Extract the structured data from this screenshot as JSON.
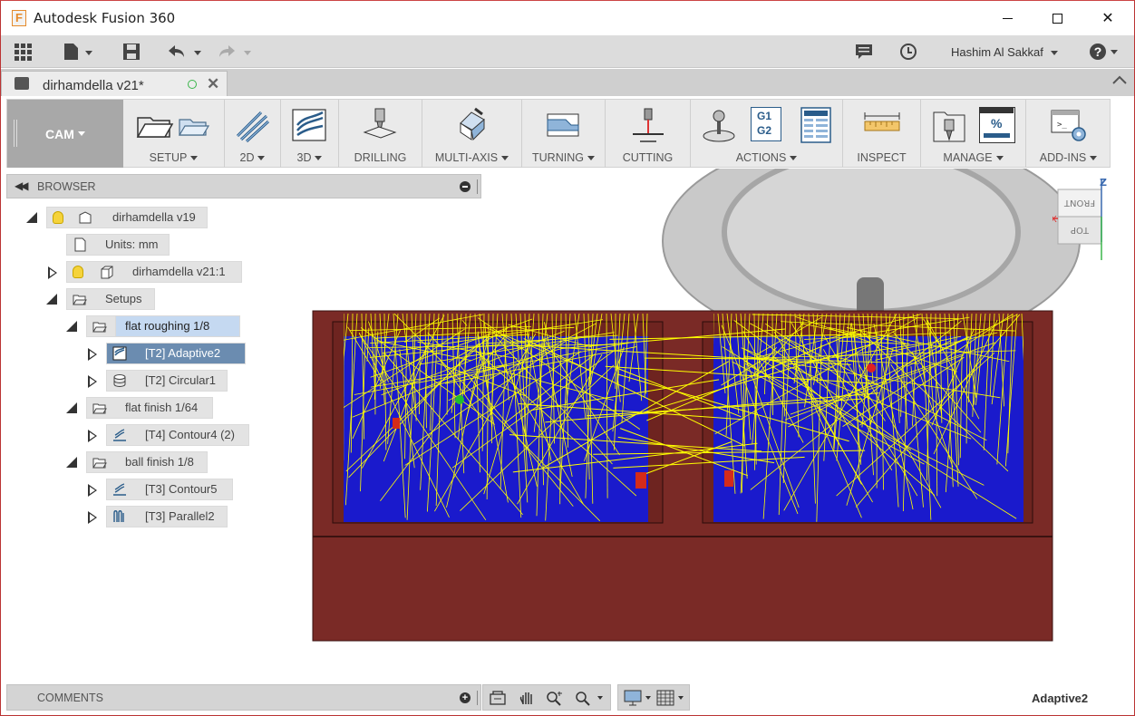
{
  "window": {
    "app_title": "Autodesk Fusion 360",
    "app_icon_letter": "F"
  },
  "quickbar": {
    "user_name": "Hashim Al Sakkaf",
    "help_label": "?"
  },
  "document_tab": {
    "title": "dirhamdella v21*"
  },
  "ribbon": {
    "workspace": "CAM",
    "groups": {
      "setup": "SETUP",
      "two_d": "2D",
      "three_d": "3D",
      "drilling": "DRILLING",
      "multi_axis": "MULTI-AXIS",
      "turning": "TURNING",
      "cutting": "CUTTING",
      "actions": "ACTIONS",
      "inspect": "INSPECT",
      "manage": "MANAGE",
      "add_ins": "ADD-INS"
    },
    "g1g2": [
      "G1",
      "G2"
    ],
    "percent": "%"
  },
  "browser": {
    "title": "BROWSER",
    "items": [
      {
        "label": "dirhamdella v19"
      },
      {
        "label": "Units: mm"
      },
      {
        "label": "dirhamdella v21:1"
      },
      {
        "label": "Setups"
      },
      {
        "label": "flat roughing 1/8"
      },
      {
        "label": "[T2] Adaptive2"
      },
      {
        "label": "[T2] Circular1"
      },
      {
        "label": "flat finish 1/64"
      },
      {
        "label": "[T4] Contour4 (2)"
      },
      {
        "label": "ball finish 1/8"
      },
      {
        "label": "[T3] Contour5"
      },
      {
        "label": "[T3] Parallel2"
      }
    ]
  },
  "viewcube": {
    "front": "FRONT",
    "top": "TOP",
    "axis_z": "Z",
    "axis_x": "X"
  },
  "comments": {
    "title": "COMMENTS"
  },
  "status": {
    "active_operation": "Adaptive2"
  },
  "colors": {
    "stock": "#7a2a26",
    "toolpath": "#ffff00",
    "model_blue": "#1a1acc",
    "selection": "#6b8cb0"
  }
}
